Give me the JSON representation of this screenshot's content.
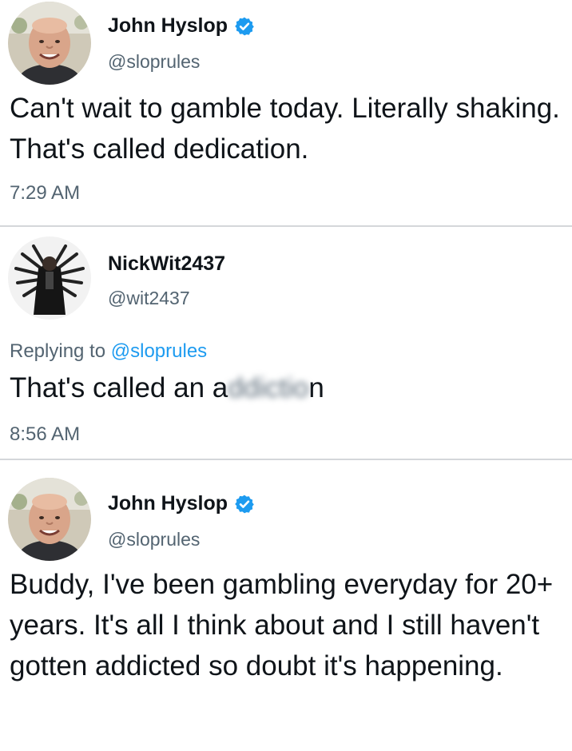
{
  "colors": {
    "text": "#0f1419",
    "secondary": "#536471",
    "link": "#1d9bf0",
    "verified_badge": "#1d9bf0",
    "divider": "#d4d7da"
  },
  "tweets": [
    {
      "avatar_icon": "bald-man-photo",
      "display_name": "John Hyslop",
      "verified_icon": "verified-badge-icon",
      "handle": "@sloprules",
      "text": "Can't wait to gamble today. Literally shaking. That's called dedication.",
      "time": "7:29 AM"
    },
    {
      "avatar_icon": "multi-armed-figure-photo",
      "display_name": "NickWit2437",
      "handle": "@wit2437",
      "reply_prefix": "Replying to",
      "reply_mention": "@sloprules",
      "text_visible_start": "That's called an a",
      "text_blurred": "ddictio",
      "text_visible_end": "n",
      "time": "8:56 AM"
    },
    {
      "avatar_icon": "bald-man-photo",
      "display_name": "John Hyslop",
      "verified_icon": "verified-badge-icon",
      "handle": "@sloprules",
      "text": "Buddy, I've been gambling everyday for 20+ years. It's all I think about and I still haven't gotten addicted so doubt it's happening."
    }
  ]
}
